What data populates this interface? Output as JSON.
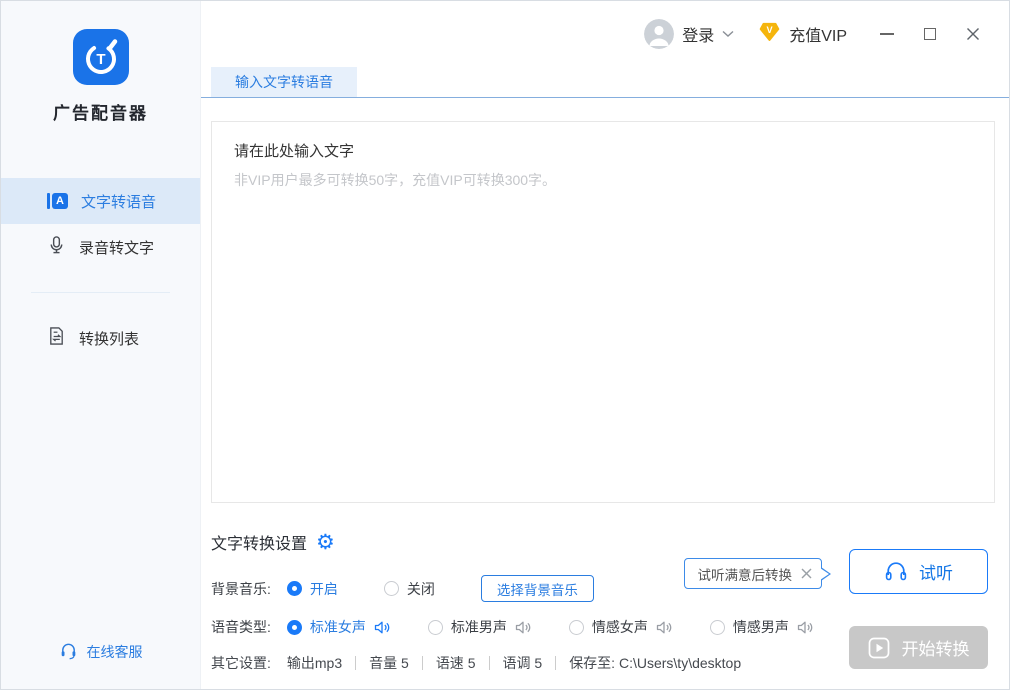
{
  "app": {
    "name": "广告配音器"
  },
  "titlebar": {
    "login": "登录",
    "vip": "充值VIP"
  },
  "sidebar": {
    "item_tts": "文字转语音",
    "item_stt": "录音转文字",
    "item_list": "转换列表",
    "support": "在线客服"
  },
  "main": {
    "tab": "输入文字转语音",
    "editor": {
      "placeholder_title": "请在此处输入文字",
      "placeholder_hint": "非VIP用户最多可转换50字，充值VIP可转换300字。"
    },
    "settings": {
      "title": "文字转换设置",
      "bgm_label": "背景音乐:",
      "bgm_on": "开启",
      "bgm_off": "关闭",
      "bgm_button": "选择背景音乐",
      "voice_label": "语音类型:",
      "voice_options": [
        {
          "label": "标准女声",
          "selected": true
        },
        {
          "label": "标准男声",
          "selected": false
        },
        {
          "label": "情感女声",
          "selected": false
        },
        {
          "label": "情感男声",
          "selected": false
        }
      ],
      "other_label": "其它设置:",
      "other_items": [
        "输出mp3",
        "音量 5",
        "语速 5",
        "语调 5",
        "保存至: C:\\Users\\ty\\desktop"
      ]
    },
    "actions": {
      "tooltip": "试听满意后转换",
      "preview": "试听",
      "convert": "开始转换"
    }
  },
  "colors": {
    "primary_blue": "#1a7af8",
    "accent_text_blue": "#2b7de0",
    "sidebar_active_bg": "#dce9f8",
    "vip_gold": "#f5b50d",
    "disabled_gray": "#c8c8c8",
    "tab_bg": "#e7f0fb"
  }
}
